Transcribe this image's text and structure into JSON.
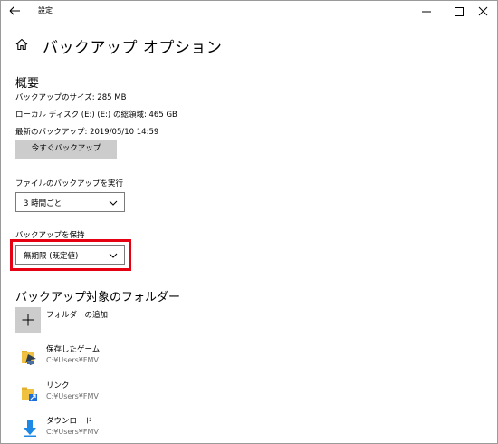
{
  "window": {
    "title": "設定"
  },
  "header": {
    "page_title": "バックアップ オプション"
  },
  "overview": {
    "heading": "概要",
    "backup_size": "バックアップのサイズ: 285 MB",
    "disk_total": "ローカル ディスク (E:) (E:) の総領域: 465 GB",
    "latest_backup": "最新のバックアップ: 2019/05/10 14:59",
    "backup_now_label": "今すぐバックアップ"
  },
  "schedule": {
    "label": "ファイルのバックアップを実行",
    "selected": "3 時間ごと"
  },
  "retention": {
    "label": "バックアップを保持",
    "selected": "無期限 (既定値)",
    "highlight_color": "#e60012"
  },
  "folders": {
    "heading": "バックアップ対象のフォルダー",
    "add_label": "フォルダーの追加",
    "items": [
      {
        "name": "保存したゲーム",
        "path": "C:¥Users¥FMV",
        "icon": "saved-games-icon"
      },
      {
        "name": "リンク",
        "path": "C:¥Users¥FMV",
        "icon": "links-icon"
      },
      {
        "name": "ダウンロード",
        "path": "C:¥Users¥FMV",
        "icon": "downloads-icon"
      }
    ]
  }
}
